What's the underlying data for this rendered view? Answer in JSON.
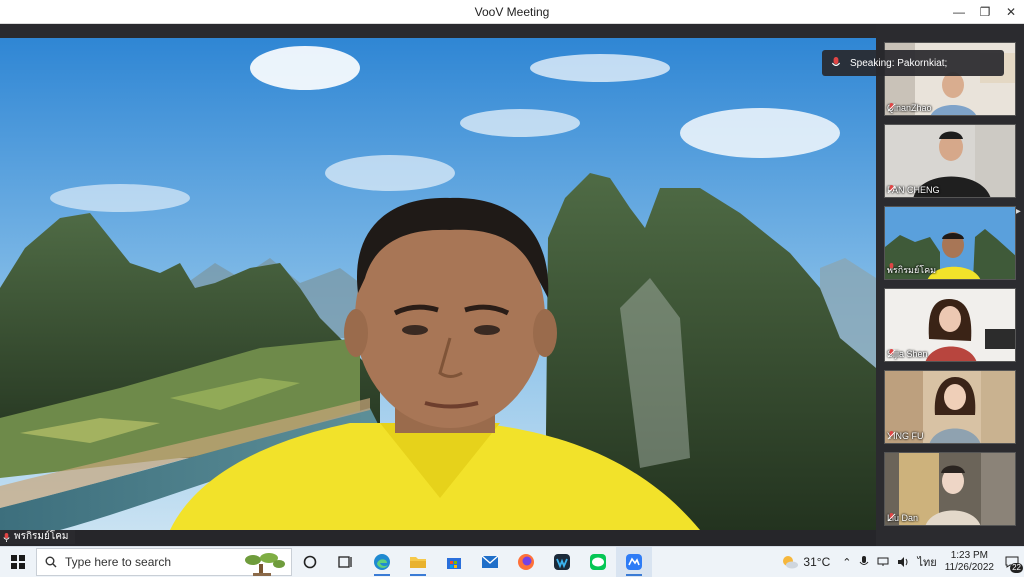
{
  "window": {
    "title": "VooV Meeting",
    "controls": {
      "minimize": "—",
      "restore": "❐",
      "close": "✕"
    }
  },
  "main_video": {
    "speaker_name": "พรกิรมย์โคม",
    "mic_icon": "mic-icon",
    "shirt_color": "#f2e22a"
  },
  "speaking_toast": {
    "label": "Speaking: Pakornkiat;"
  },
  "gallery": {
    "scroll_icon": "chevron-right-icon",
    "participants": [
      {
        "name": "QinanZhao"
      },
      {
        "name": "FAN CHENG"
      },
      {
        "name": "พรกิรมย์โคม"
      },
      {
        "name": "Sijia Shen"
      },
      {
        "name": "YING FU"
      },
      {
        "name": "Liu Dan"
      }
    ]
  },
  "taskbar": {
    "search_placeholder": "Type here to search",
    "apps": [
      "task-view",
      "edge",
      "file-explorer",
      "store",
      "mail",
      "firefox",
      "webex",
      "line",
      "voov-meeting"
    ],
    "weather": {
      "temp": "31°C"
    },
    "language": "ไทย",
    "time": "1:23 PM",
    "date": "11/26/2022",
    "notification_count": "22"
  },
  "colors": {
    "accent": "#3a7bd5",
    "gallery_bg": "#2b2b2f",
    "taskbar_bg": "#eef3f8"
  }
}
